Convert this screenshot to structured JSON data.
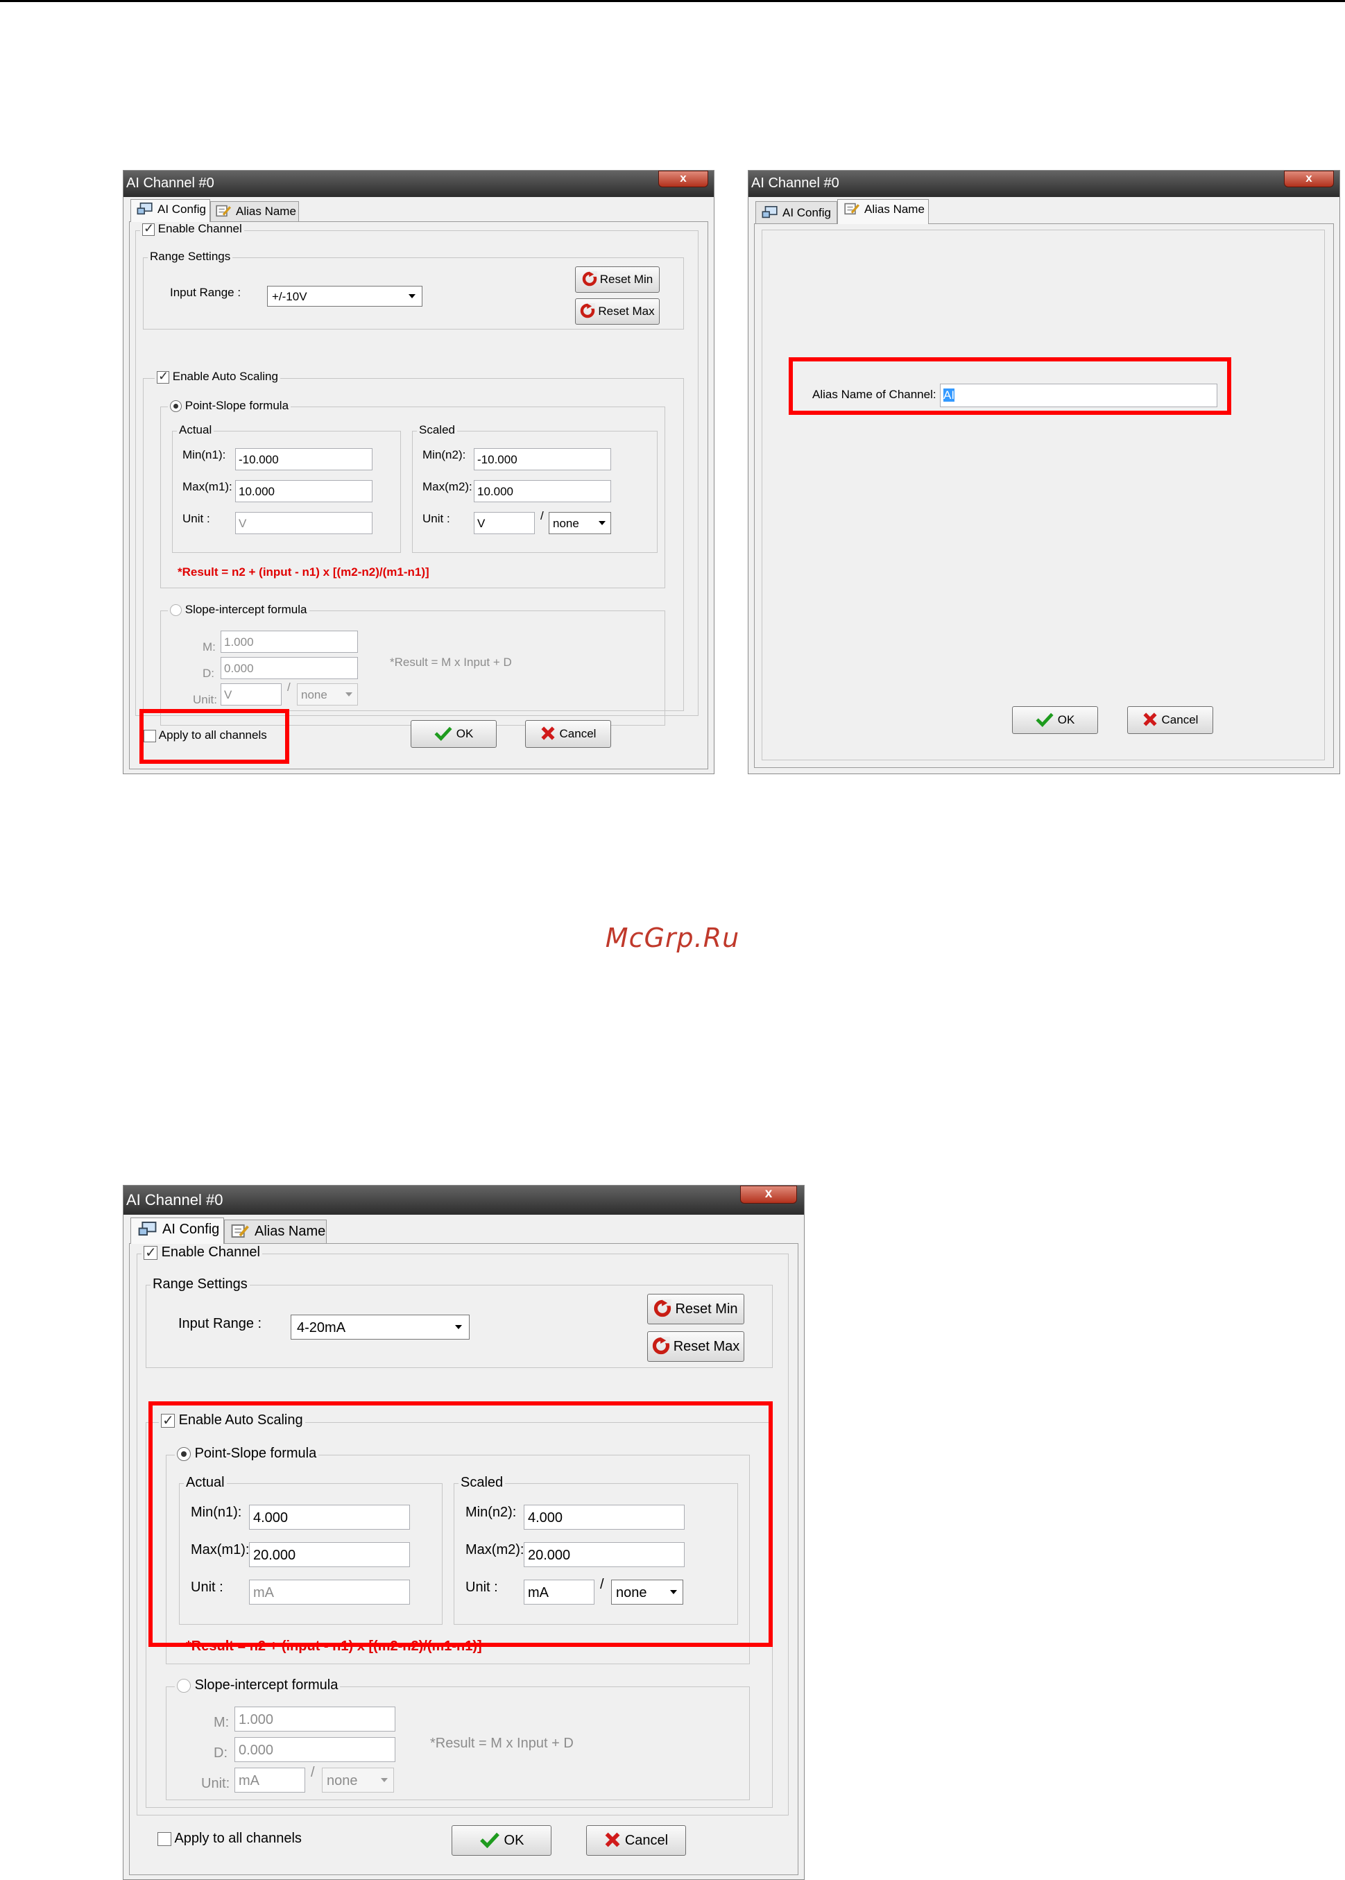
{
  "watermark": "McGrp.Ru",
  "colors": {
    "highlight": "#ff0000",
    "formula": "#e00000",
    "watermark": "#c0392b"
  },
  "dialog1": {
    "title": "AI Channel #0",
    "close_label": "x",
    "tabs": [
      "AI Config",
      "Alias Name"
    ],
    "enable_channel": "Enable Channel",
    "range_settings": "Range Settings",
    "input_range_label": "Input Range :",
    "input_range_value": "+/-10V",
    "reset_min": "Reset Min",
    "reset_max": "Reset Max",
    "enable_auto_scaling": "Enable Auto Scaling",
    "point_slope": "Point-Slope formula",
    "actual": "Actual",
    "scaled": "Scaled",
    "min_n1_label": "Min(n1):",
    "min_n1": "-10.000",
    "max_m1_label": "Max(m1):",
    "max_m1": "10.000",
    "unit_label": "Unit :",
    "unit_actual": "V",
    "min_n2_label": "Min(n2):",
    "min_n2": "-10.000",
    "max_m2_label": "Max(m2):",
    "max_m2": "10.000",
    "unit_scaled": "V",
    "slash": "/",
    "per_unit": "none",
    "formula": "*Result = n2 + (input - n1) x [(m2-n2)/(m1-n1)]",
    "slope_intercept": "Slope-intercept formula",
    "m_label": "M:",
    "m_value": "1.000",
    "d_label": "D:",
    "d_value": "0.000",
    "unit2_label": "Unit:",
    "unit2_value": "V",
    "per_unit2": "none",
    "formula2": "*Result = M x Input + D",
    "apply_all": "Apply to all channels",
    "ok": "OK",
    "cancel": "Cancel"
  },
  "dialog2": {
    "title": "AI Channel #0",
    "close_label": "x",
    "tabs": [
      "AI Config",
      "Alias Name"
    ],
    "alias_label": "Alias Name of Channel:",
    "alias_value": "AI",
    "ok": "OK",
    "cancel": "Cancel"
  },
  "dialog3": {
    "title": "AI Channel #0",
    "close_label": "x",
    "tabs": [
      "AI Config",
      "Alias Name"
    ],
    "enable_channel": "Enable Channel",
    "range_settings": "Range Settings",
    "input_range_label": "Input Range :",
    "input_range_value": "4-20mA",
    "reset_min": "Reset Min",
    "reset_max": "Reset Max",
    "enable_auto_scaling": "Enable Auto Scaling",
    "point_slope": "Point-Slope formula",
    "actual": "Actual",
    "scaled": "Scaled",
    "min_n1_label": "Min(n1):",
    "min_n1": "4.000",
    "max_m1_label": "Max(m1):",
    "max_m1": "20.000",
    "unit_label": "Unit :",
    "unit_actual": "mA",
    "min_n2_label": "Min(n2):",
    "min_n2": "4.000",
    "max_m2_label": "Max(m2):",
    "max_m2": "20.000",
    "unit_scaled": "mA",
    "slash": "/",
    "per_unit": "none",
    "formula": "*Result = n2 + (input - n1) x [(m2-n2)/(m1-n1)]",
    "slope_intercept": "Slope-intercept formula",
    "m_label": "M:",
    "m_value": "1.000",
    "d_label": "D:",
    "d_value": "0.000",
    "unit2_label": "Unit:",
    "unit2_value": "mA",
    "per_unit2": "none",
    "formula2": "*Result = M x Input + D",
    "apply_all": "Apply to all channels",
    "ok": "OK",
    "cancel": "Cancel"
  }
}
